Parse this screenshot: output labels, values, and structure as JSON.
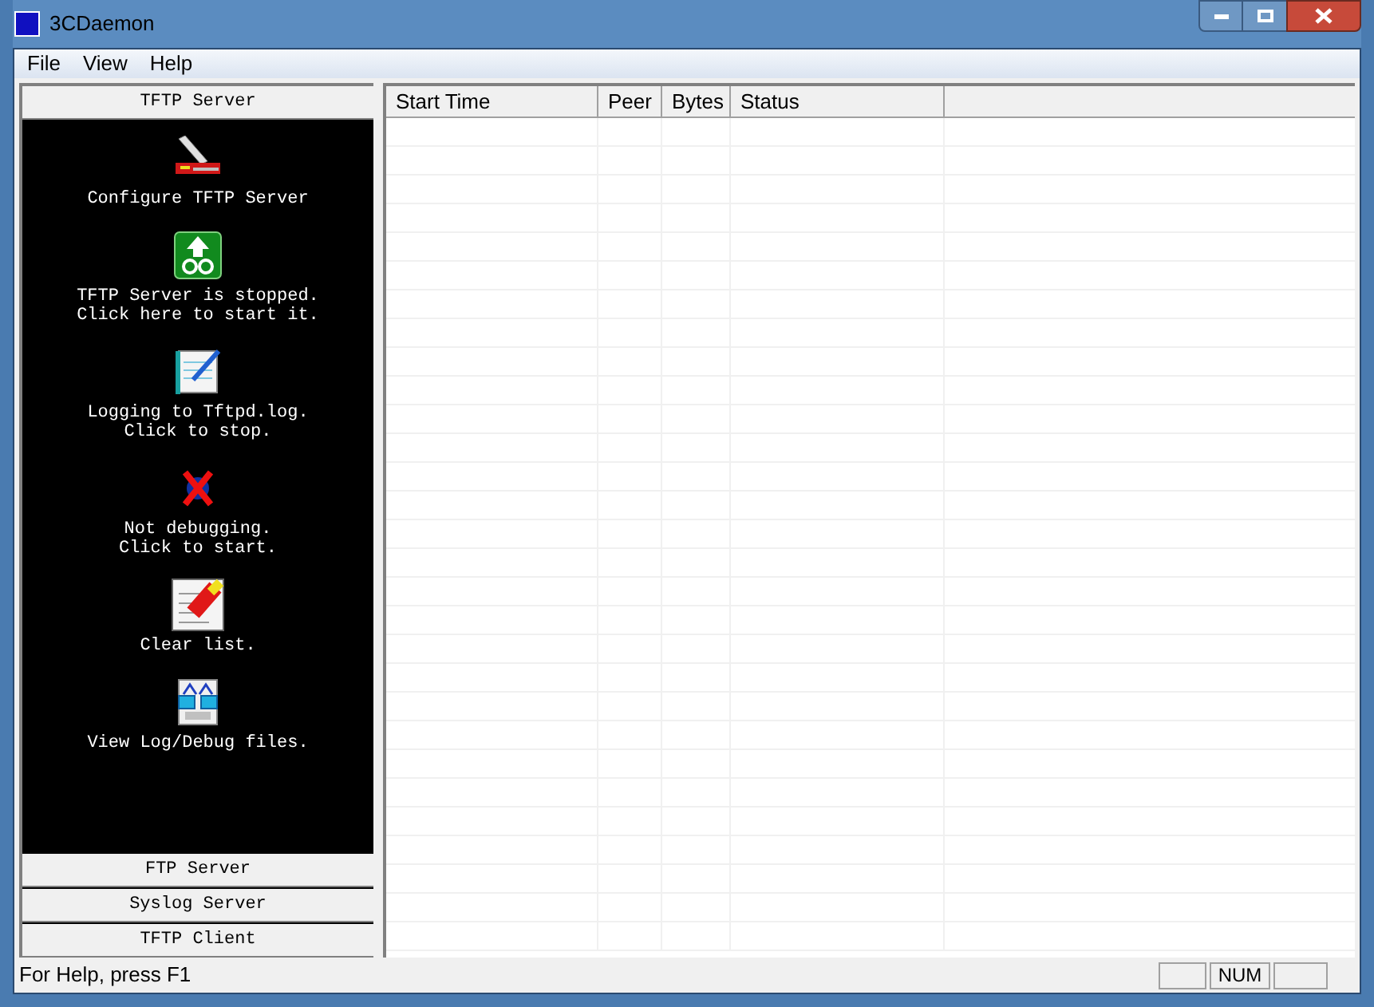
{
  "window": {
    "title": "3CDaemon"
  },
  "menu": [
    "File",
    "View",
    "Help"
  ],
  "left_panel": {
    "header": "TFTP Server",
    "actions": [
      {
        "kind": "knife",
        "lines": [
          "Configure TFTP Server"
        ]
      },
      {
        "kind": "go",
        "lines": [
          "TFTP Server is stopped.",
          "Click here to start it."
        ]
      },
      {
        "kind": "log",
        "lines": [
          "Logging to Tftpd.log.",
          "Click to stop."
        ]
      },
      {
        "kind": "debug",
        "lines": [
          "Not debugging.",
          "Click to start."
        ]
      },
      {
        "kind": "clear",
        "lines": [
          "Clear list."
        ]
      },
      {
        "kind": "view",
        "lines": [
          "View Log/Debug files."
        ]
      }
    ],
    "sections": [
      "FTP Server",
      "Syslog Server",
      "TFTP Client"
    ]
  },
  "table": {
    "columns": [
      "Start Time",
      "Peer",
      "Bytes",
      "Status"
    ]
  },
  "status_bar": {
    "help": "For Help, press F1",
    "indicator": "NUM"
  }
}
